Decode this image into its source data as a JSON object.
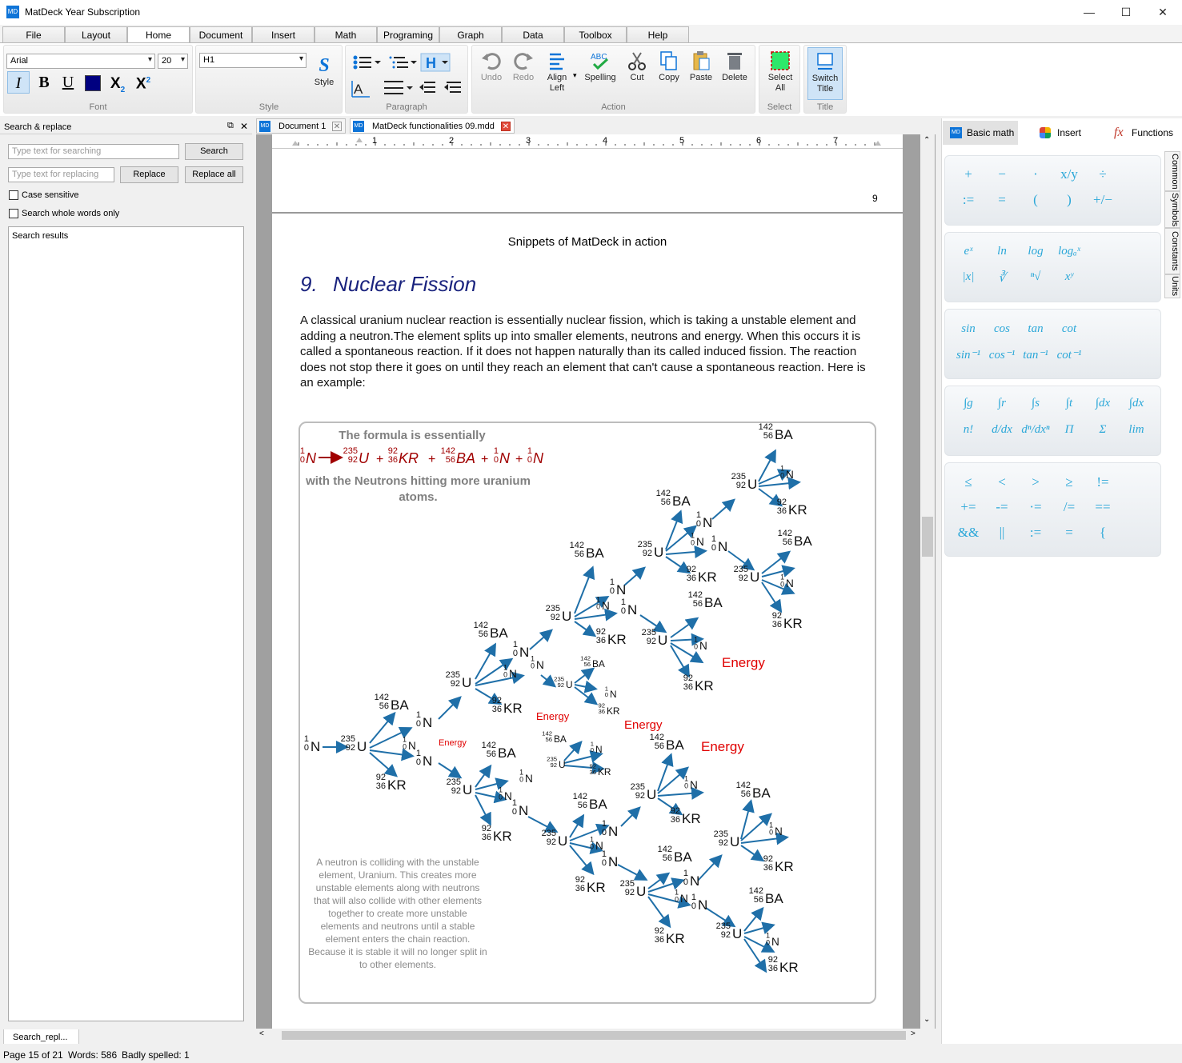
{
  "window": {
    "title": "MatDeck Year Subscription",
    "icon": "MD",
    "min": "—",
    "max": "☐",
    "close": "✕"
  },
  "menu": {
    "tabs": [
      "File",
      "Layout",
      "Home",
      "Document",
      "Insert",
      "Math",
      "Programing",
      "Graph",
      "Data",
      "Toolbox",
      "Help"
    ],
    "active": "Home"
  },
  "ribbon": {
    "font": {
      "family": "Arial",
      "size": "20",
      "label": "Font"
    },
    "style": {
      "value": "H1",
      "button": "Style",
      "label": "Style"
    },
    "paragraph": {
      "label": "Paragraph"
    },
    "action": {
      "undo": "Undo",
      "redo": "Redo",
      "align": "Align Left",
      "spelling": "Spelling",
      "cut": "Cut",
      "copy": "Copy",
      "paste": "Paste",
      "delete": "Delete",
      "label": "Action"
    },
    "select": {
      "button": "Select All",
      "label": "Select"
    },
    "title": {
      "button": "Switch Title",
      "label": "Title"
    }
  },
  "search": {
    "header": "Search & replace",
    "search_placeholder": "Type text for searching",
    "search_button": "Search",
    "replace_placeholder": "Type text for replacing",
    "replace_button": "Replace",
    "replace_all": "Replace all",
    "case": "Case sensitive",
    "whole": "Search whole words only",
    "results": "Search results",
    "bottom_tab": "Search_repl..."
  },
  "doc_tabs": [
    {
      "label": "Document 1"
    },
    {
      "label": "MatDeck functionalities 09.mdd"
    }
  ],
  "ruler": [
    "1",
    "2",
    "3",
    "4",
    "5",
    "6",
    "7"
  ],
  "document": {
    "page_number": "9",
    "running_title": "Snippets of MatDeck in action",
    "heading_num": "9.",
    "heading": "Nuclear Fission",
    "paragraph": "A classical uranium nuclear reaction is essentially nuclear fission, which is taking a unstable element and adding a neutron.The element splits up into smaller elements, neutrons and energy. When this occurs it is called a spontaneous reaction. If it does not happen naturally than its called induced fission. The reaction does not stop there it goes on until they reach an element that can't cause a spontaneous reaction. Here is an example:"
  },
  "figure": {
    "formula_title": "The formula is essentially",
    "formula_sub": "with the Neutrons hitting more uranium atoms.",
    "note": "A neutron is colliding with the unstable element, Uranium. This creates more unstable elements along with neutrons that will also collide with other elements together to create more unstable elements and neutrons until a stable element enters the chain reaction. Because it is stable it will no longer split in to other elements.",
    "energy": "Energy",
    "symbols": {
      "U": "U",
      "BA": "BA",
      "KR": "KR",
      "N": "N",
      "u_mass": "235",
      "u_num": "92",
      "ba_mass": "142",
      "ba_num": "56",
      "kr_mass": "92",
      "kr_num": "36",
      "n_mass": "1",
      "n_num": "0"
    }
  },
  "right_panel": {
    "tabs": [
      "Basic math",
      "Insert",
      "Functions"
    ],
    "side_tabs": [
      "Common",
      "Symbols",
      "Constants",
      "Units"
    ],
    "row1": [
      "+",
      "−",
      "·",
      "x/y",
      "÷",
      ":=",
      "=",
      "(",
      ")",
      "+/−"
    ],
    "row2": [
      "eˣ",
      "ln",
      "log",
      "logₐˣ",
      "|x|",
      "∛",
      "ⁿ√",
      "xʸ"
    ],
    "row3": [
      "sin",
      "cos",
      "tan",
      "cot",
      "sin⁻¹",
      "cos⁻¹",
      "tan⁻¹",
      "cot⁻¹"
    ],
    "row4": [
      "∫g",
      "∫r",
      "∫s",
      "∫t",
      "∫dx",
      "∫dx",
      "n!",
      "d/dx",
      "dⁿ/dxⁿ",
      "Π",
      "Σ",
      "lim"
    ],
    "row5": [
      "≤",
      "<",
      ">",
      "≥",
      "!=",
      "+=",
      "-=",
      "·=",
      "/=",
      "==",
      "&&",
      "||",
      ":=",
      "=",
      "{"
    ]
  },
  "status": {
    "page": "Page 15 of 21",
    "words": "Words: 586",
    "spelled": "Badly spelled: 1"
  },
  "colors": {
    "accent": "#0e74d8",
    "heading": "#1a237e",
    "formula": "#a00000",
    "arrow": "#1f6fa8",
    "energy": "#e00000",
    "math": "#2aa7d8"
  }
}
